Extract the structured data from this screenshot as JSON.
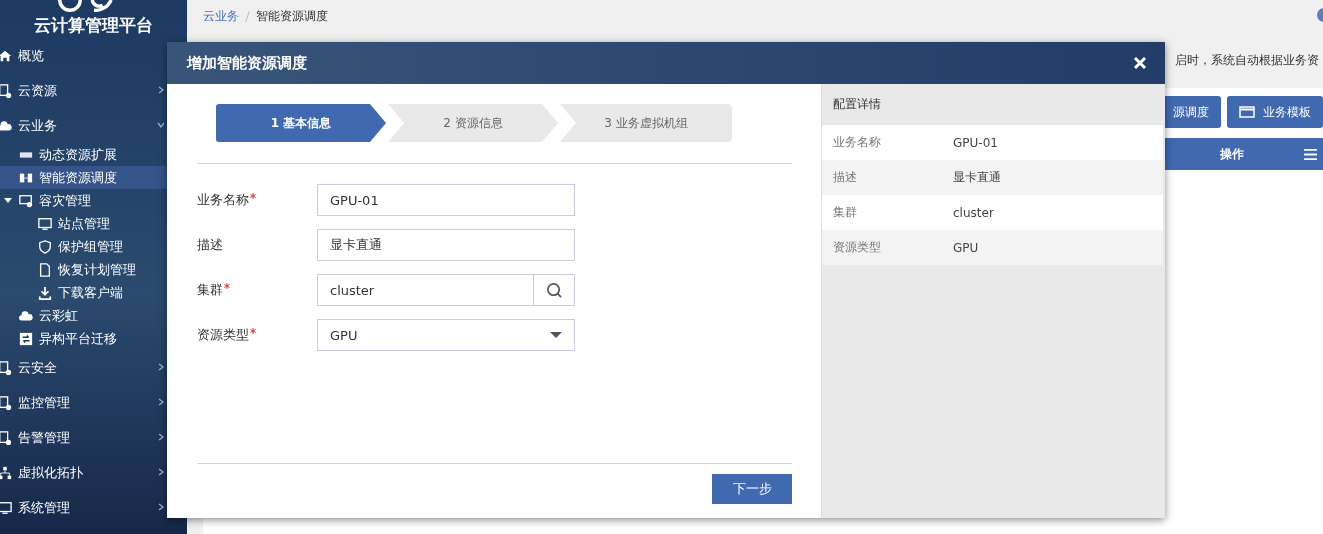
{
  "sidebar": {
    "title": "云计算管理平台",
    "items": [
      {
        "label": "概览",
        "selected": false
      },
      {
        "label": "云资源",
        "selected": false
      },
      {
        "label": "云业务",
        "selected": false,
        "expanded": true,
        "children": [
          {
            "label": "动态资源扩展",
            "selected": false
          },
          {
            "label": "智能资源调度",
            "selected": true
          },
          {
            "label": "容灾管理",
            "selected": false,
            "expanded": true,
            "children": [
              {
                "label": "站点管理",
                "selected": false
              },
              {
                "label": "保护组管理",
                "selected": false
              },
              {
                "label": "恢复计划管理",
                "selected": false
              },
              {
                "label": "下载客户端",
                "selected": false
              }
            ]
          },
          {
            "label": "云彩虹",
            "selected": false
          },
          {
            "label": "异构平台迁移",
            "selected": false
          }
        ]
      },
      {
        "label": "云安全",
        "selected": false
      },
      {
        "label": "监控管理",
        "selected": false
      },
      {
        "label": "告警管理",
        "selected": false
      },
      {
        "label": "虚拟化拓扑",
        "selected": false
      },
      {
        "label": "系统管理",
        "selected": false
      }
    ]
  },
  "breadcrumb": [
    {
      "label": "云业务",
      "link": true
    },
    {
      "label": "智能资源调度",
      "link": false
    }
  ],
  "notice": "启时，系统自动根据业务资",
  "toolbar": [
    "源调度",
    "业务模板"
  ],
  "table": {
    "columns": [
      "操作"
    ]
  },
  "dialog": {
    "title": "增加智能资源调度",
    "steps": [
      {
        "label": "1 基本信息",
        "selected": true
      },
      {
        "label": "2 资源信息",
        "selected": false
      },
      {
        "label": "3 业务虚拟机组",
        "selected": false
      }
    ],
    "fields": [
      {
        "label": "业务名称",
        "required": true,
        "kind": "text",
        "value": "GPU-01"
      },
      {
        "label": "描述",
        "required": false,
        "kind": "text",
        "value": "显卡直通"
      },
      {
        "label": "集群",
        "required": true,
        "kind": "search",
        "value": "cluster"
      },
      {
        "label": "资源类型",
        "required": true,
        "kind": "select",
        "value": "GPU"
      }
    ],
    "next_button": "下一步",
    "details": {
      "title": "配置详情",
      "rows": [
        {
          "label": "业务名称",
          "value": "GPU-01"
        },
        {
          "label": "描述",
          "value": "显卡直通"
        },
        {
          "label": "集群",
          "value": "cluster"
        },
        {
          "label": "资源类型",
          "value": "GPU"
        }
      ]
    }
  }
}
